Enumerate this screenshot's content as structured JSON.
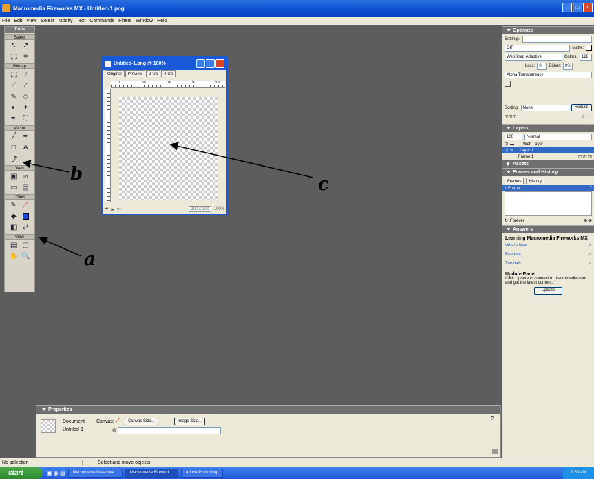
{
  "window": {
    "title": "Macromedia Fireworks MX - Untitled-1.png"
  },
  "menu": [
    "File",
    "Edit",
    "View",
    "Select",
    "Modify",
    "Text",
    "Commands",
    "Filters",
    "Window",
    "Help"
  ],
  "toolbox": {
    "title": "Tools",
    "sections": [
      "Select",
      "Bitmap",
      "Vector",
      "Web",
      "Colors",
      "View"
    ]
  },
  "document": {
    "title": "Untitled-1.png @ 100%",
    "tabs": [
      "Original",
      "Preview",
      "2-Up",
      "4-Up"
    ],
    "ruler_marks": [
      "0",
      "50",
      "100",
      "150",
      "200"
    ],
    "dimensions": "200 x 200",
    "zoom": "100%"
  },
  "annotations": {
    "a": "a",
    "b": "b",
    "c": "c"
  },
  "optimize": {
    "header": "Optimize",
    "settings_label": "Settings:",
    "format": "GIF",
    "matte_label": "Matte:",
    "palette": "WebSnap Adaptive",
    "colors_label": "Colors:",
    "colors_value": "128",
    "loss_label": "Loss:",
    "loss_value": "0",
    "dither_label": "Dither:",
    "dither_value": "0%",
    "transparency": "Alpha Transparency",
    "sorting_label": "Sorting:",
    "sorting_value": "None",
    "rebuild_btn": "Rebuild"
  },
  "layers": {
    "header": "Layers",
    "opacity": "100",
    "blend": "Normal",
    "rows": [
      "Web Layer",
      "Layer 1"
    ],
    "frame": "Frame 1"
  },
  "assets": {
    "header": "Assets"
  },
  "frames": {
    "header": "Frames and History",
    "tabs": [
      "Frames",
      "History"
    ],
    "frame_row": "1  Frame 1",
    "frame_num": "7",
    "forever": "Forever"
  },
  "answers": {
    "header": "Answers",
    "title": "Learning Macromedia Fireworks MX",
    "links": [
      "What's New",
      "Readme",
      "Tutorials"
    ],
    "update_title": "Update Panel",
    "update_text": "Click Update to connect to macromedia.com and get the latest content.",
    "update_btn": "Update"
  },
  "properties": {
    "header": "Properties",
    "doc_label": "Document",
    "doc_name": "Untitled-1",
    "canvas_label": "Canvas:",
    "canvas_size_btn": "Canvas Size...",
    "image_size_btn": "Image Size..."
  },
  "status": {
    "left": "No selection",
    "middle": "Select and move objects"
  },
  "taskbar": {
    "start": "start",
    "tasks": [
      "Macromedia Dreamwe...",
      "Macromedia Firework...",
      "Adobe Photoshop"
    ],
    "clock": "9:50 AM"
  },
  "colors": {
    "titlebar": "#0a4fd0",
    "background": "#5d5d5d",
    "panel": "#ece9d8",
    "selection": "#316ac5"
  }
}
